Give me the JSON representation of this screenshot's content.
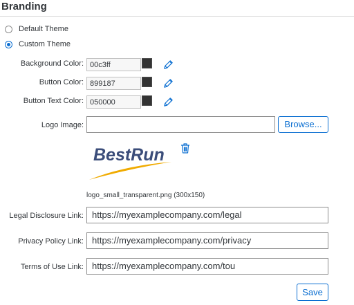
{
  "section": {
    "title": "Branding"
  },
  "theme": {
    "options": [
      {
        "label": "Default Theme",
        "selected": false
      },
      {
        "label": "Custom Theme",
        "selected": true
      }
    ]
  },
  "colors": {
    "background": {
      "label": "Background Color:",
      "value": "00c3ff",
      "swatch": "#333333"
    },
    "button": {
      "label": "Button Color:",
      "value": "899187",
      "swatch": "#333333"
    },
    "button_text": {
      "label": "Button Text Color:",
      "value": "050000",
      "swatch": "#333333"
    }
  },
  "logo": {
    "label": "Logo Image:",
    "value": "",
    "browse_label": "Browse...",
    "brand_text": "BestRun",
    "caption": "logo_small_transparent.png (300x150)"
  },
  "links": {
    "legal": {
      "label": "Legal Disclosure Link:",
      "value": "https://myexamplecompany.com/legal"
    },
    "privacy": {
      "label": "Privacy Policy Link:",
      "value": "https://myexamplecompany.com/privacy"
    },
    "terms": {
      "label": "Terms of Use Link:",
      "value": "https://myexamplecompany.com/tou"
    }
  },
  "actions": {
    "save_label": "Save"
  },
  "icons": {
    "edit": "pencil-icon",
    "delete": "trash-icon"
  },
  "palette": {
    "accent": "#0a6ed1",
    "logo_blue": "#3b4d7a",
    "logo_swoosh": "#f0ab00"
  }
}
